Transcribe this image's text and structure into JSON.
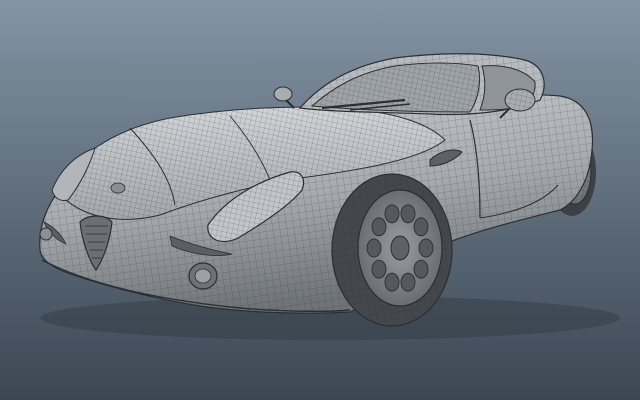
{
  "scene": {
    "subject": "car-wireframe-model",
    "render_style": "wireframe-on-shaded",
    "colors": {
      "bg_top": "#8494a4",
      "bg_bottom": "#3b4753",
      "body_light": "#c9ccd0",
      "body_mid": "#a7abaf",
      "body_dark": "#6f7479",
      "wire": "#2b2f33",
      "tire": "#4a4e52",
      "wheel_face": "#8d9195"
    }
  }
}
